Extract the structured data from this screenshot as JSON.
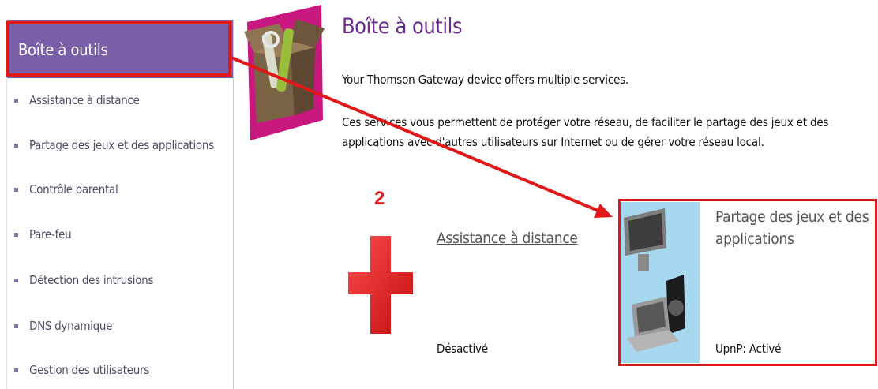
{
  "sidebar": {
    "title": "Boîte à outils",
    "items": [
      {
        "label": "Assistance à distance"
      },
      {
        "label": "Partage des jeux et des applications"
      },
      {
        "label": "Contrôle parental"
      },
      {
        "label": "Pare-feu"
      },
      {
        "label": "Détection des intrusions"
      },
      {
        "label": "DNS dynamique"
      },
      {
        "label": "Gestion des utilisateurs"
      }
    ]
  },
  "main": {
    "title": "Boîte à outils",
    "intro": "Your Thomson Gateway device offers multiple services.",
    "description_line1": "Ces services vous permettent de protéger votre réseau, de faciliter le partage des jeux et des",
    "description_line2": "applications avec d'autres utilisateurs sur Internet ou de gérer votre réseau local."
  },
  "annotation": {
    "step_number": "2"
  },
  "services": [
    {
      "label": "Assistance à distance",
      "status": "Désactivé",
      "icon": "red-cross-icon"
    },
    {
      "label_line1": "Partage des jeux et des",
      "label_line2": "applications",
      "status": "UpnP: Activé",
      "icon": "computers-network-icon"
    }
  ],
  "colors": {
    "sidebar_header": "#7a5ea8",
    "title": "#6a2a8c",
    "highlight": "#e01818",
    "nav_text": "#4d4d66"
  }
}
